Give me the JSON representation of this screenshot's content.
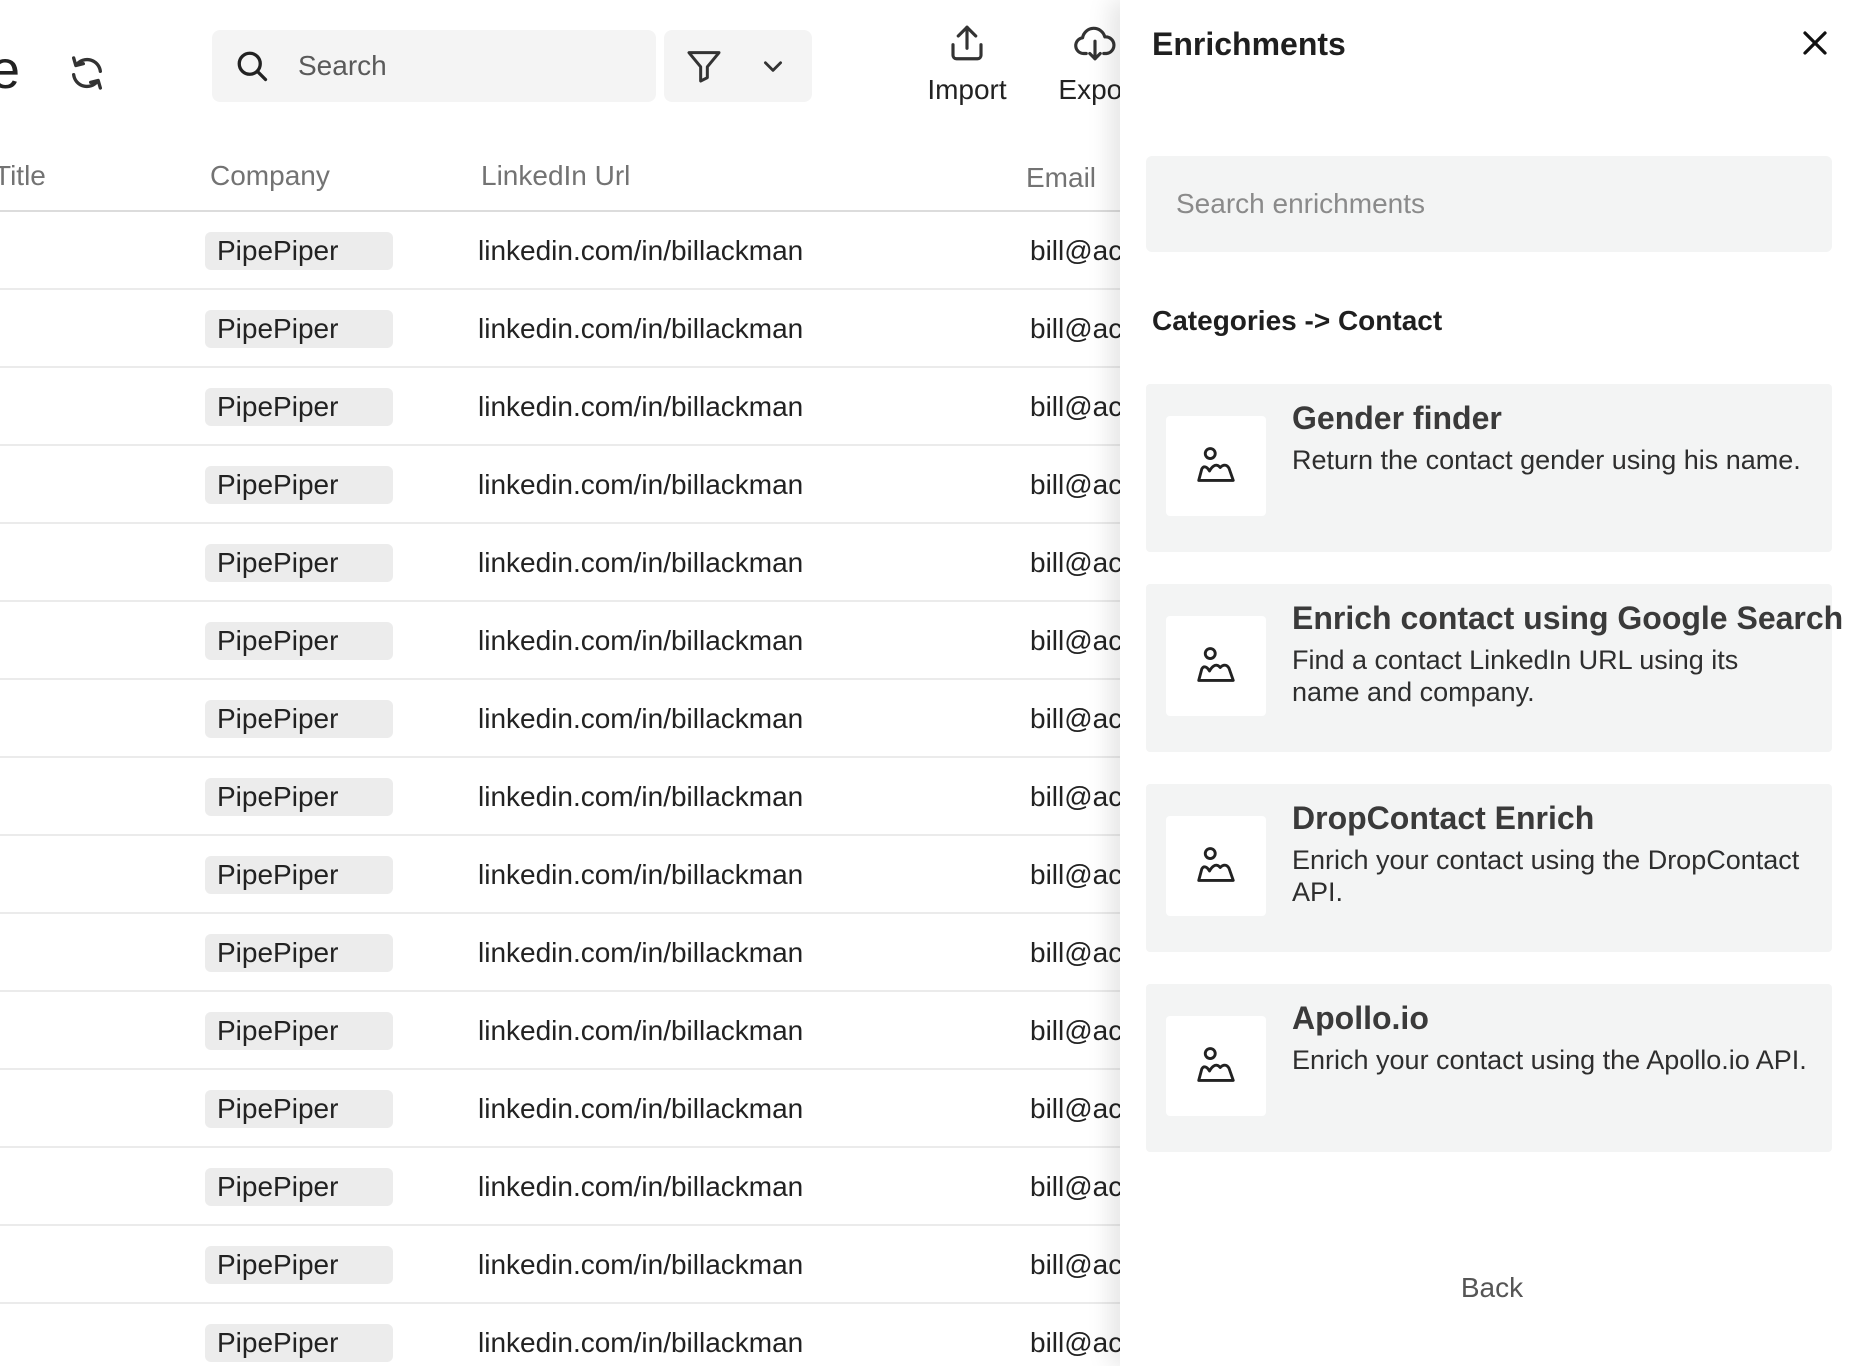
{
  "header": {
    "title_fragment": "e",
    "search_placeholder": "Search",
    "actions": {
      "import_label": "Import",
      "export_label": "Expor"
    }
  },
  "table": {
    "columns": {
      "title": "Title",
      "company": "Company",
      "linkedin": "LinkedIn Url",
      "email": "Email"
    },
    "rows": [
      {
        "company": "PipePiper",
        "linkedin": "linkedin.com/in/billackman",
        "email": "bill@ac"
      },
      {
        "company": "PipePiper",
        "linkedin": "linkedin.com/in/billackman",
        "email": "bill@ac"
      },
      {
        "company": "PipePiper",
        "linkedin": "linkedin.com/in/billackman",
        "email": "bill@ac"
      },
      {
        "company": "PipePiper",
        "linkedin": "linkedin.com/in/billackman",
        "email": "bill@ac"
      },
      {
        "company": "PipePiper",
        "linkedin": "linkedin.com/in/billackman",
        "email": "bill@ac"
      },
      {
        "company": "PipePiper",
        "linkedin": "linkedin.com/in/billackman",
        "email": "bill@ac"
      },
      {
        "company": "PipePiper",
        "linkedin": "linkedin.com/in/billackman",
        "email": "bill@ac"
      },
      {
        "company": "PipePiper",
        "linkedin": "linkedin.com/in/billackman",
        "email": "bill@ac"
      },
      {
        "company": "PipePiper",
        "linkedin": "linkedin.com/in/billackman",
        "email": "bill@ac"
      },
      {
        "company": "PipePiper",
        "linkedin": "linkedin.com/in/billackman",
        "email": "bill@ac"
      },
      {
        "company": "PipePiper",
        "linkedin": "linkedin.com/in/billackman",
        "email": "bill@ac"
      },
      {
        "company": "PipePiper",
        "linkedin": "linkedin.com/in/billackman",
        "email": "bill@ac"
      },
      {
        "company": "PipePiper",
        "linkedin": "linkedin.com/in/billackman",
        "email": "bill@ac"
      },
      {
        "company": "PipePiper",
        "linkedin": "linkedin.com/in/billackman",
        "email": "bill@ac"
      },
      {
        "company": "PipePiper",
        "linkedin": "linkedin.com/in/billackman",
        "email": "bill@ac"
      }
    ]
  },
  "panel": {
    "title": "Enrichments",
    "search_placeholder": "Search enrichments",
    "breadcrumb": "Categories -> Contact",
    "cards": [
      {
        "title": "Gender finder",
        "description": "Return the contact gender using his name."
      },
      {
        "title": "Enrich contact using Google Search",
        "description": "Find a contact LinkedIn URL using its name and  company."
      },
      {
        "title": "DropContact Enrich",
        "description": "Enrich your contact using the DropContact API."
      },
      {
        "title": "Apollo.io",
        "description": "Enrich your contact using the Apollo.io API."
      }
    ],
    "back_label": "Back"
  },
  "icons": {
    "refresh": "refresh-icon",
    "search": "search-icon",
    "filter": "filter-icon",
    "chevron": "chevron-down-icon",
    "import": "upload-icon",
    "export": "cloud-download-icon",
    "close": "close-icon",
    "card_thumb": "contact-image-icon"
  }
}
